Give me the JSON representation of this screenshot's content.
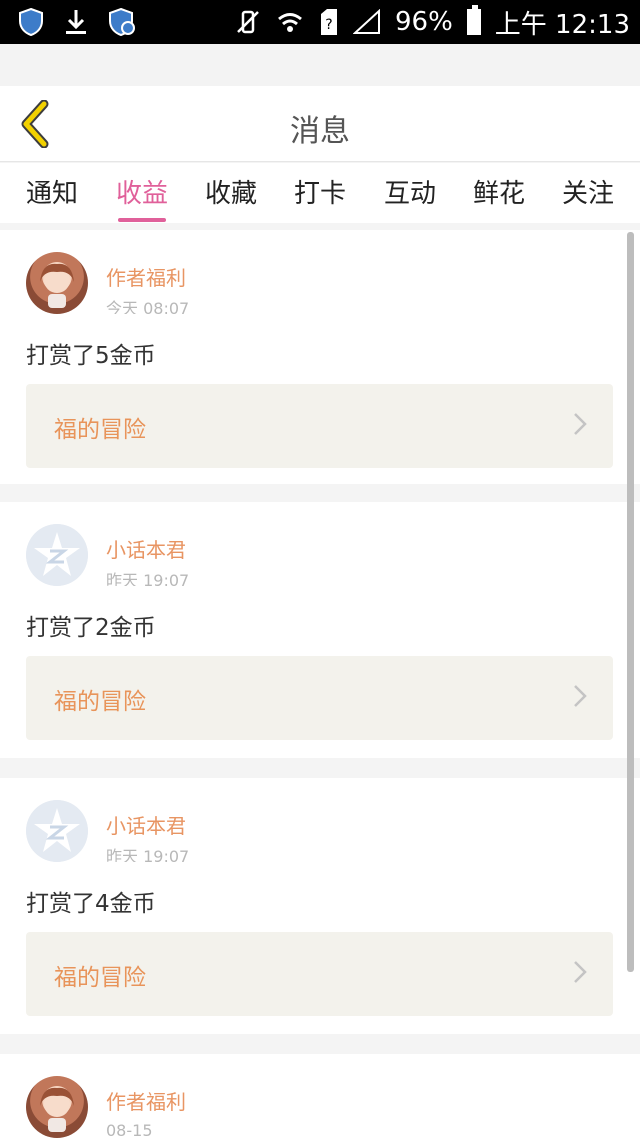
{
  "status_bar": {
    "battery": "96%",
    "time": "上午 12:13"
  },
  "header": {
    "title": "消息"
  },
  "tabs": [
    {
      "label": "通知"
    },
    {
      "label": "收益"
    },
    {
      "label": "收藏"
    },
    {
      "label": "打卡"
    },
    {
      "label": "互动"
    },
    {
      "label": "鲜花"
    },
    {
      "label": "关注"
    }
  ],
  "active_tab": "收益",
  "messages": [
    {
      "sender": "作者福利",
      "time": "今天 08:07",
      "text": "打赏了5金币",
      "link": "福的冒险",
      "avatar": "anime-girl-avatar"
    },
    {
      "sender": "小话本君",
      "time": "昨天 19:07",
      "text": "打赏了2金币",
      "link": "福的冒险",
      "avatar": "qq-avatar"
    },
    {
      "sender": "小话本君",
      "time": "昨天 19:07",
      "text": "打赏了4金币",
      "link": "福的冒险",
      "avatar": "qq-avatar"
    },
    {
      "sender": "作者福利",
      "time": "08-15",
      "text": "",
      "link": "",
      "avatar": "anime-girl-avatar"
    }
  ],
  "colors": {
    "accent": "#e0609a",
    "sender": "#e89563",
    "link": "#e8945a",
    "back_arrow": "#e5c200"
  }
}
